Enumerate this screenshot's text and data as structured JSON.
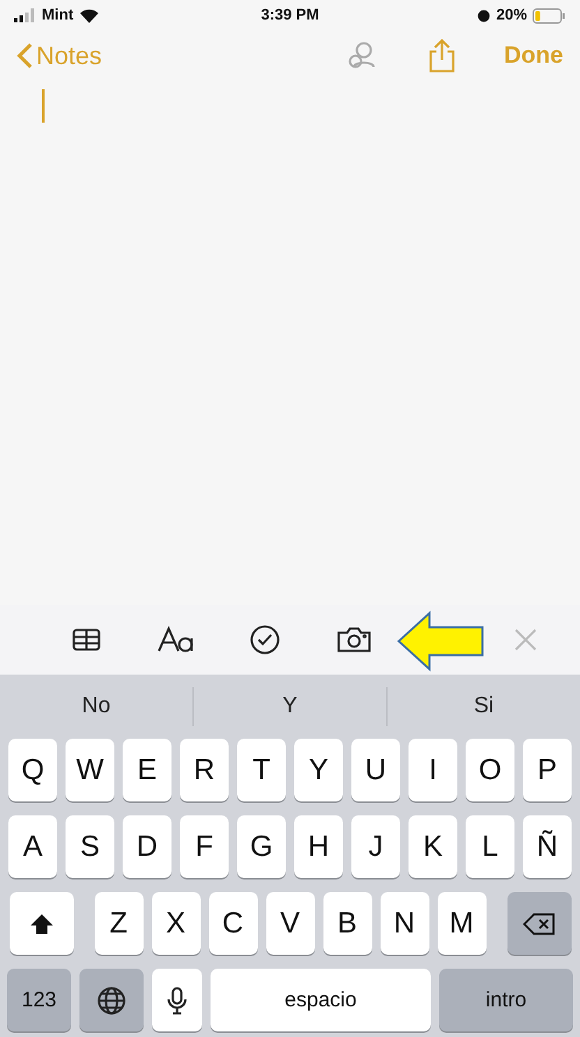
{
  "status_bar": {
    "carrier": "Mint",
    "time": "3:39 PM",
    "battery": "20%"
  },
  "nav": {
    "back": "Notes",
    "done": "Done"
  },
  "suggestions": [
    "No",
    "Y",
    "Si"
  ],
  "keyboard": {
    "rows": [
      [
        "Q",
        "W",
        "E",
        "R",
        "T",
        "Y",
        "U",
        "I",
        "O",
        "P"
      ],
      [
        "A",
        "S",
        "D",
        "F",
        "G",
        "H",
        "J",
        "K",
        "L",
        "Ñ"
      ],
      [
        "Z",
        "X",
        "C",
        "V",
        "B",
        "N",
        "M"
      ]
    ],
    "bottom": [
      {
        "kind": "mode",
        "label": "123"
      },
      {
        "kind": "globe"
      },
      {
        "kind": "mic"
      },
      {
        "kind": "space",
        "label": "espacio"
      },
      {
        "kind": "return",
        "label": "intro"
      }
    ]
  }
}
